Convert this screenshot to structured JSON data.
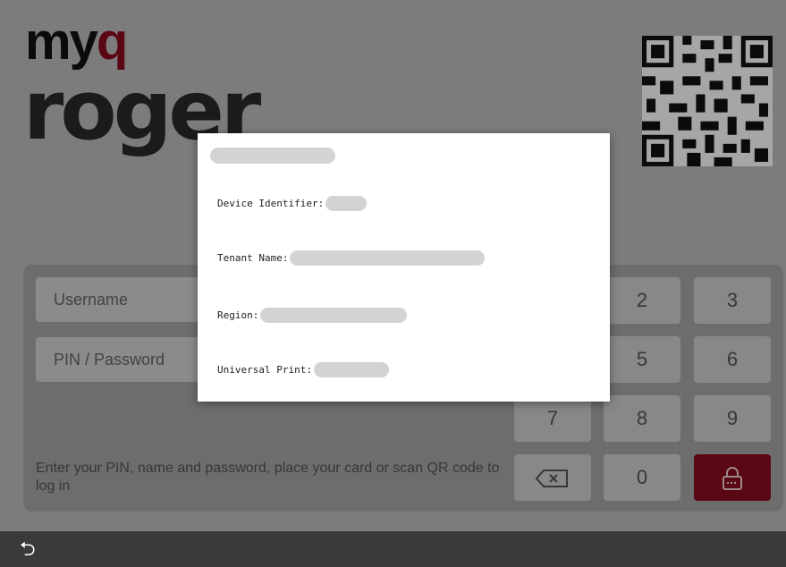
{
  "brand": {
    "logo_part1": "my",
    "logo_q": "q",
    "logo_part2": "roger",
    "accent": "#8a0a1e"
  },
  "login": {
    "username_placeholder": "Username",
    "pin_placeholder": "PIN / Password",
    "hint": "Enter your PIN, name and password, place your card or scan QR code to log in",
    "keys": [
      "2",
      "3",
      "5",
      "6",
      "7",
      "8",
      "9",
      "0"
    ]
  },
  "dialog": {
    "device_identifier_label": "Device Identifier:",
    "tenant_name_label": "Tenant Name:",
    "region_label": "Region:",
    "universal_print_label": "Universal Print:"
  },
  "icons": {
    "backspace": "backspace-icon",
    "login": "unlock-icon",
    "back": "back-arrow-icon",
    "qr": "qr-code-icon"
  }
}
